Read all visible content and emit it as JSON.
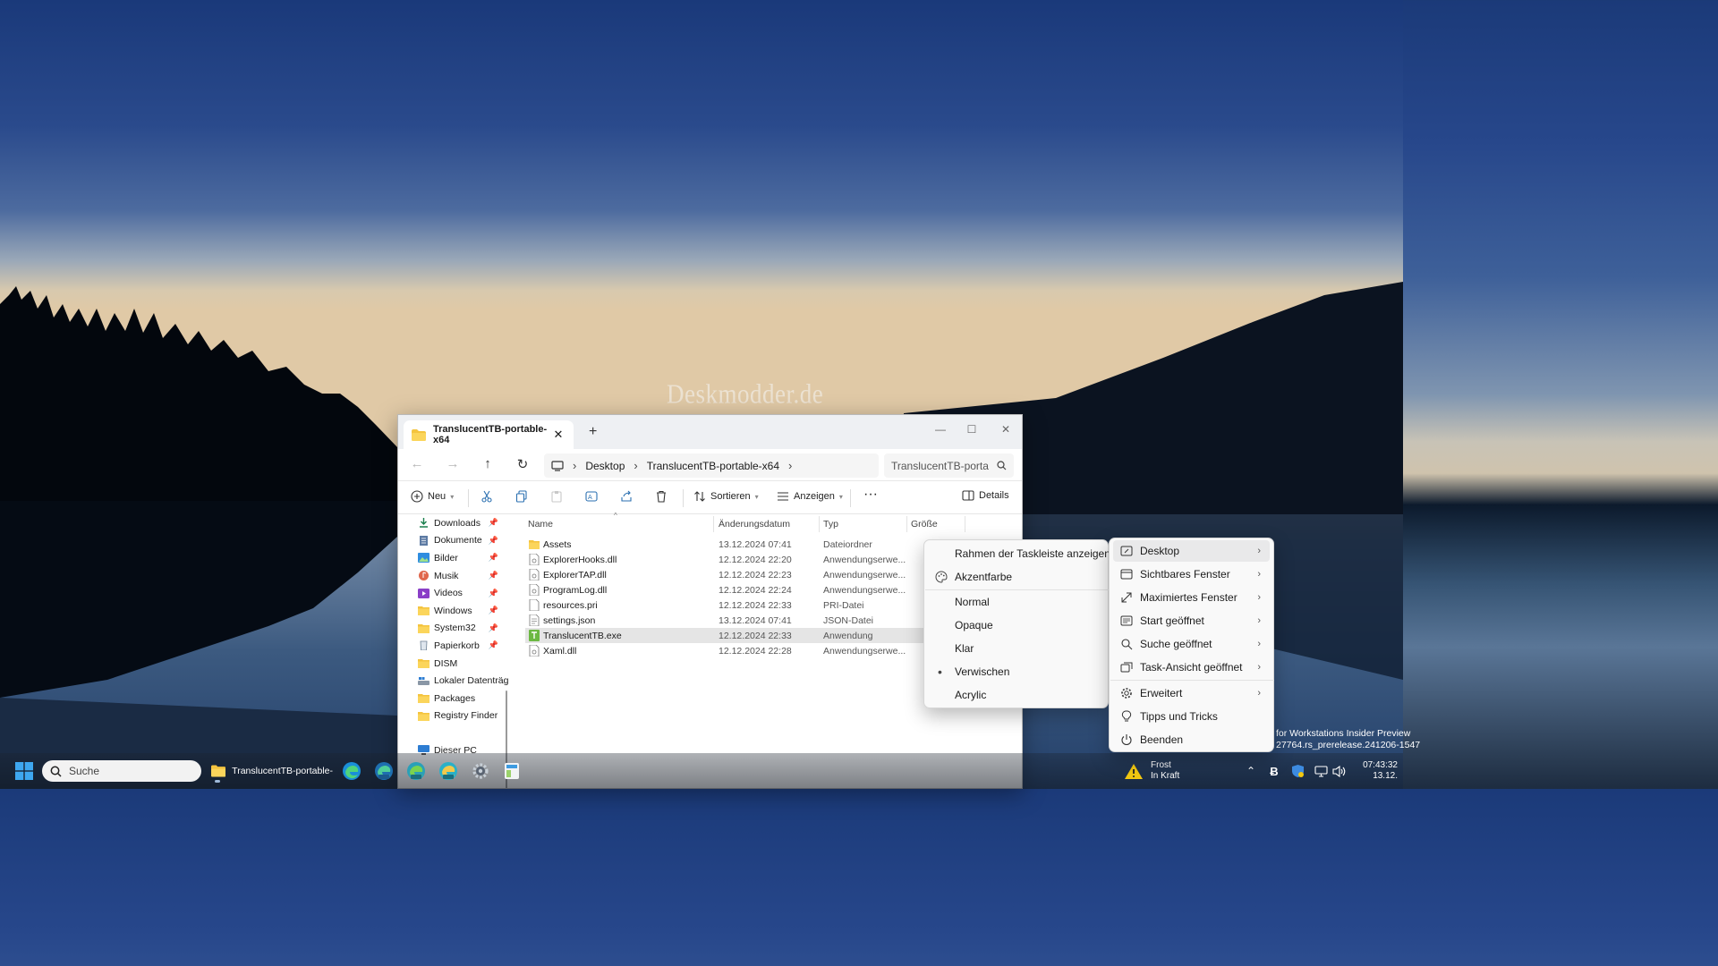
{
  "desktop": {
    "watermark": "Deskmodder.de",
    "build_info_line1": "for Workstations Insider Preview",
    "build_info_line2": "27764.rs_prerelease.241206-1547"
  },
  "explorer": {
    "tab_title": "TranslucentTB-portable-x64",
    "breadcrumb": [
      "Desktop",
      "TranslucentTB-portable-x64"
    ],
    "search_placeholder": "TranslucentTB-porta",
    "commands": {
      "new": "Neu",
      "sort": "Sortieren",
      "view": "Anzeigen",
      "details": "Details"
    },
    "nav_items": [
      {
        "label": "Downloads",
        "icon": "download-icon",
        "pinned": true
      },
      {
        "label": "Dokumente",
        "icon": "document-icon",
        "pinned": true
      },
      {
        "label": "Bilder",
        "icon": "pictures-icon",
        "pinned": true
      },
      {
        "label": "Musik",
        "icon": "music-icon",
        "pinned": true
      },
      {
        "label": "Videos",
        "icon": "video-icon",
        "pinned": true
      },
      {
        "label": "Windows",
        "icon": "folder-icon",
        "pinned": true
      },
      {
        "label": "System32",
        "icon": "folder-icon",
        "pinned": true
      },
      {
        "label": "Papierkorb",
        "icon": "recycle-bin-icon",
        "pinned": true
      },
      {
        "label": "DISM",
        "icon": "folder-icon",
        "pinned": false
      },
      {
        "label": "Lokaler Datenträg",
        "icon": "drive-icon",
        "pinned": false
      },
      {
        "label": "Packages",
        "icon": "folder-icon",
        "pinned": false
      },
      {
        "label": "Registry Finder",
        "icon": "folder-icon",
        "pinned": false
      }
    ],
    "this_pc": "Dieser PC",
    "columns": [
      "Name",
      "Änderungsdatum",
      "Typ",
      "Größe"
    ],
    "files": [
      {
        "name": "Assets",
        "date": "13.12.2024 07:41",
        "type": "Dateiordner",
        "icon": "folder-icon"
      },
      {
        "name": "ExplorerHooks.dll",
        "date": "12.12.2024 22:20",
        "type": "Anwendungserwe...",
        "icon": "dll-file-icon"
      },
      {
        "name": "ExplorerTAP.dll",
        "date": "12.12.2024 22:23",
        "type": "Anwendungserwe...",
        "icon": "dll-file-icon"
      },
      {
        "name": "ProgramLog.dll",
        "date": "12.12.2024 22:24",
        "type": "Anwendungserwe...",
        "icon": "dll-file-icon"
      },
      {
        "name": "resources.pri",
        "date": "12.12.2024 22:33",
        "type": "PRI-Datei",
        "icon": "file-icon"
      },
      {
        "name": "settings.json",
        "date": "13.12.2024 07:41",
        "type": "JSON-Datei",
        "icon": "json-file-icon"
      },
      {
        "name": "TranslucentTB.exe",
        "date": "12.12.2024 22:33",
        "type": "Anwendung",
        "icon": "exe-file-icon",
        "selected": true
      },
      {
        "name": "Xaml.dll",
        "date": "12.12.2024 22:28",
        "type": "Anwendungserwe...",
        "icon": "dll-file-icon"
      }
    ]
  },
  "submenu": {
    "items": [
      {
        "label": "Rahmen der Taskleiste anzeigen",
        "icon": ""
      },
      {
        "label": "Akzentfarbe",
        "icon": "palette-icon"
      },
      {
        "label": "Normal",
        "icon": ""
      },
      {
        "label": "Opaque",
        "icon": ""
      },
      {
        "label": "Klar",
        "icon": ""
      },
      {
        "label": "Verwischen",
        "icon": "",
        "selected": true
      },
      {
        "label": "Acrylic",
        "icon": ""
      }
    ]
  },
  "main_menu": {
    "items": [
      {
        "label": "Desktop",
        "icon": "desktop-icon",
        "submenu": true,
        "hover": true
      },
      {
        "label": "Sichtbares Fenster",
        "icon": "window-icon",
        "submenu": true
      },
      {
        "label": "Maximiertes Fenster",
        "icon": "maximize-icon",
        "submenu": true
      },
      {
        "label": "Start geöffnet",
        "icon": "start-icon",
        "submenu": true
      },
      {
        "label": "Suche geöffnet",
        "icon": "search-icon",
        "submenu": true
      },
      {
        "label": "Task-Ansicht geöffnet",
        "icon": "task-view-icon",
        "submenu": true
      },
      {
        "label": "Erweitert",
        "icon": "gear-icon",
        "submenu": true
      },
      {
        "label": "Tipps und Tricks",
        "icon": "lightbulb-icon",
        "submenu": false
      },
      {
        "label": "Beenden",
        "icon": "power-icon",
        "submenu": false
      }
    ]
  },
  "taskbar": {
    "search_label": "Suche",
    "running_app_label": "TranslucentTB-portable-",
    "weather_title": "Frost",
    "weather_subtitle": "In Kraft",
    "time": "07:43:32",
    "date": "13.12."
  }
}
